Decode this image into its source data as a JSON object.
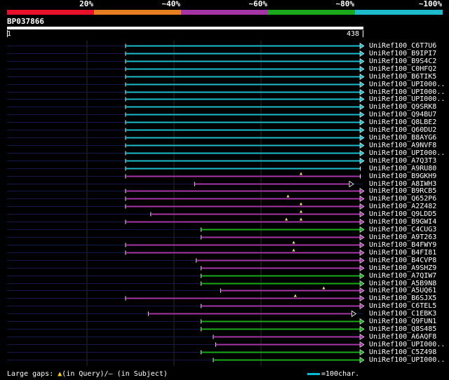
{
  "legend": {
    "segments": [
      {
        "color": "#e8102a"
      },
      {
        "color": "#e67e22"
      },
      {
        "color": "#a535a5"
      },
      {
        "color": "#1aa91a"
      },
      {
        "color": "#1cbccc"
      }
    ],
    "labels": [
      "20%",
      "~40%",
      "~60%",
      "~80%",
      "~100%"
    ]
  },
  "query": {
    "id": "BP037866",
    "start": "1",
    "end": "438"
  },
  "hits": [
    {
      "label": "UniRef100_C6T7U6",
      "color": "#1cbccc",
      "start": 146,
      "end": 438,
      "end_marker": "arrow",
      "gaps": []
    },
    {
      "label": "UniRef100_B9IPI7",
      "color": "#1cbccc",
      "start": 146,
      "end": 438,
      "end_marker": "arrow",
      "gaps": []
    },
    {
      "label": "UniRef100_B9S4C2",
      "color": "#1cbccc",
      "start": 146,
      "end": 438,
      "end_marker": "arrow",
      "gaps": []
    },
    {
      "label": "UniRef100_C0HFQ2",
      "color": "#1cbccc",
      "start": 146,
      "end": 438,
      "end_marker": "arrow",
      "gaps": []
    },
    {
      "label": "UniRef100_B6TIK5",
      "color": "#1cbccc",
      "start": 146,
      "end": 438,
      "end_marker": "arrow",
      "gaps": []
    },
    {
      "label": "UniRef100_UPI000..",
      "color": "#1cbccc",
      "start": 146,
      "end": 438,
      "end_marker": "arrow",
      "gaps": []
    },
    {
      "label": "UniRef100_UPI000..",
      "color": "#1cbccc",
      "start": 146,
      "end": 438,
      "end_marker": "arrow",
      "gaps": []
    },
    {
      "label": "UniRef100_UPI000..",
      "color": "#1cbccc",
      "start": 146,
      "end": 438,
      "end_marker": "arrow",
      "gaps": []
    },
    {
      "label": "UniRef100_Q9SRK8",
      "color": "#1cbccc",
      "start": 146,
      "end": 438,
      "end_marker": "arrow",
      "gaps": []
    },
    {
      "label": "UniRef100_Q94BU7",
      "color": "#1cbccc",
      "start": 146,
      "end": 438,
      "end_marker": "arrow",
      "gaps": []
    },
    {
      "label": "UniRef100_Q8LBE2",
      "color": "#1cbccc",
      "start": 146,
      "end": 438,
      "end_marker": "arrow",
      "gaps": []
    },
    {
      "label": "UniRef100_Q60DU2",
      "color": "#1cbccc",
      "start": 146,
      "end": 438,
      "end_marker": "arrow",
      "gaps": []
    },
    {
      "label": "UniRef100_B8AYG6",
      "color": "#1cbccc",
      "start": 146,
      "end": 438,
      "end_marker": "arrow",
      "gaps": []
    },
    {
      "label": "UniRef100_A9NVF8",
      "color": "#1cbccc",
      "start": 146,
      "end": 438,
      "end_marker": "arrow",
      "gaps": []
    },
    {
      "label": "UniRef100_UPI000..",
      "color": "#1cbccc",
      "start": 146,
      "end": 438,
      "end_marker": "arrow",
      "gaps": []
    },
    {
      "label": "UniRef100_A7Q3T3",
      "color": "#1cbccc",
      "start": 146,
      "end": 438,
      "end_marker": "arrow",
      "gaps": []
    },
    {
      "label": "UniRef100_A9RU80",
      "color": "#1cbccc",
      "start": 146,
      "end": 435,
      "end_marker": "bar",
      "gaps": []
    },
    {
      "label": "UniRef100_B9GKH9",
      "color": "#a535a5",
      "start": 146,
      "end": 435,
      "end_marker": "bar",
      "gaps": [
        362
      ]
    },
    {
      "label": "UniRef100_A8IWH3",
      "color": "#a535a5",
      "start": 231,
      "end": 425,
      "end_marker": "triangle",
      "gaps": []
    },
    {
      "label": "UniRef100_B9RCB5",
      "color": "#a535a5",
      "start": 146,
      "end": 438,
      "end_marker": "arrow",
      "gaps": []
    },
    {
      "label": "UniRef100_Q652P6",
      "color": "#a535a5",
      "start": 146,
      "end": 438,
      "end_marker": "arrow",
      "gaps": [
        346
      ]
    },
    {
      "label": "UniRef100_A2Z482",
      "color": "#a535a5",
      "start": 146,
      "end": 438,
      "end_marker": "arrow",
      "gaps": [
        362
      ]
    },
    {
      "label": "UniRef100_Q9LDD5",
      "color": "#a535a5",
      "start": 177,
      "end": 438,
      "end_marker": "arrow",
      "gaps": [
        362
      ]
    },
    {
      "label": "UniRef100_B9GWI4",
      "color": "#a535a5",
      "start": 146,
      "end": 438,
      "end_marker": "arrow",
      "gaps": [
        344,
        362
      ]
    },
    {
      "label": "UniRef100_C4CUG3",
      "color": "#1aa91a",
      "start": 239,
      "end": 438,
      "end_marker": "arrow",
      "gaps": []
    },
    {
      "label": "UniRef100_A9T263",
      "color": "#a535a5",
      "start": 239,
      "end": 438,
      "end_marker": "arrow",
      "gaps": []
    },
    {
      "label": "UniRef100_B4FWY9",
      "color": "#a535a5",
      "start": 146,
      "end": 438,
      "end_marker": "arrow",
      "gaps": [
        353
      ]
    },
    {
      "label": "UniRef100_B4FI81",
      "color": "#a535a5",
      "start": 146,
      "end": 438,
      "end_marker": "arrow",
      "gaps": [
        353
      ]
    },
    {
      "label": "UniRef100_B4CVP8",
      "color": "#a535a5",
      "start": 233,
      "end": 438,
      "end_marker": "arrow",
      "gaps": []
    },
    {
      "label": "UniRef100_A9SHZ9",
      "color": "#a535a5",
      "start": 239,
      "end": 438,
      "end_marker": "arrow",
      "gaps": []
    },
    {
      "label": "UniRef100_A7QIW7",
      "color": "#1aa91a",
      "start": 239,
      "end": 438,
      "end_marker": "arrow",
      "gaps": []
    },
    {
      "label": "UniRef100_A5B9N8",
      "color": "#1aa91a",
      "start": 239,
      "end": 438,
      "end_marker": "arrow",
      "gaps": []
    },
    {
      "label": "UniRef100_A5UQ61",
      "color": "#a535a5",
      "start": 263,
      "end": 438,
      "end_marker": "arrow",
      "gaps": [
        390
      ]
    },
    {
      "label": "UniRef100_B6SJX5",
      "color": "#a535a5",
      "start": 146,
      "end": 438,
      "end_marker": "arrow",
      "gaps": [
        355
      ]
    },
    {
      "label": "UniRef100_C6TEL5",
      "color": "#a535a5",
      "start": 239,
      "end": 438,
      "end_marker": "arrow",
      "gaps": []
    },
    {
      "label": "UniRef100_C1EBK3",
      "color": "#a535a5",
      "start": 174,
      "end": 428,
      "end_marker": "triangle",
      "gaps": []
    },
    {
      "label": "UniRef100_Q9FUN1",
      "color": "#1aa91a",
      "start": 239,
      "end": 438,
      "end_marker": "arrow",
      "gaps": []
    },
    {
      "label": "UniRef100_Q8S485",
      "color": "#1aa91a",
      "start": 239,
      "end": 438,
      "end_marker": "arrow",
      "gaps": []
    },
    {
      "label": "UniRef100_A6AQF8",
      "color": "#a535a5",
      "start": 254,
      "end": 438,
      "end_marker": "arrow",
      "gaps": []
    },
    {
      "label": "UniRef100_UPI000..",
      "color": "#a535a5",
      "start": 257,
      "end": 438,
      "end_marker": "arrow",
      "gaps": []
    },
    {
      "label": "UniRef100_C5Z498",
      "color": "#1aa91a",
      "start": 239,
      "end": 438,
      "end_marker": "arrow",
      "gaps": []
    },
    {
      "label": "UniRef100_UPI000..",
      "color": "#1aa91a",
      "start": 254,
      "end": 438,
      "end_marker": "arrow",
      "gaps": []
    }
  ],
  "footer": {
    "gaps_prefix": "Large gaps:",
    "gaps_triangle": "▲",
    "gaps_query": "(in Query)",
    "gaps_sep": "/",
    "gaps_dash": "–",
    "gaps_subject": "(in Subject)",
    "scale_text": "=100char."
  }
}
